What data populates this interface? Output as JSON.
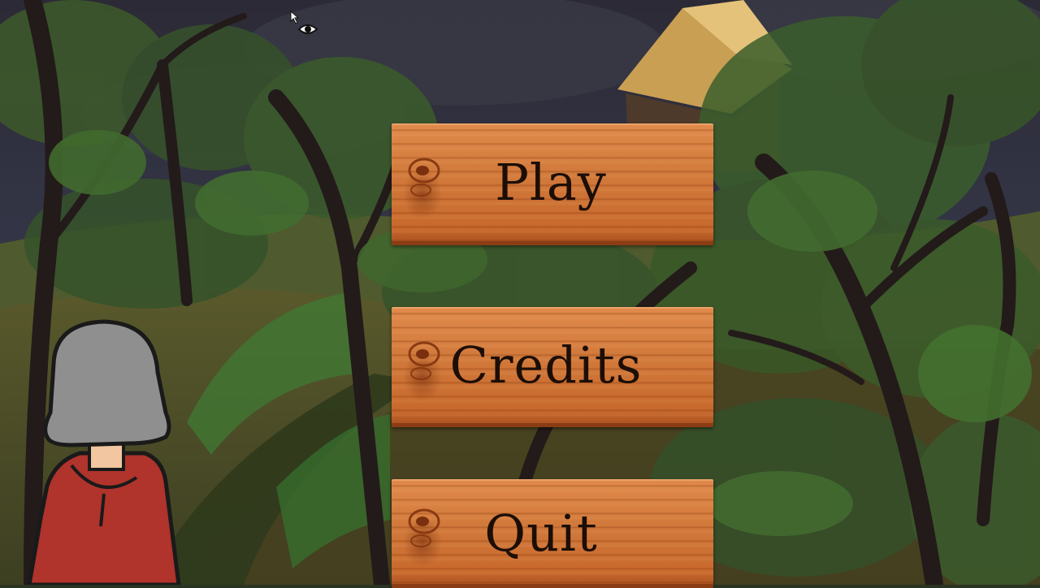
{
  "menu": {
    "play_label": "Play",
    "credits_label": "Credits",
    "quit_label": "Quit"
  },
  "icons": {
    "cursor": "arrow-with-eye-cursor-icon",
    "character": "grey-haired-red-hooded-character"
  },
  "colors": {
    "wood_light": "#e08a4c",
    "wood_dark": "#a84f1f",
    "label_text": "#1c0e06",
    "sky": "#2e2c38",
    "foliage": "#3b5a2a",
    "hood": "#b0332c",
    "hair": "#8c8c8c"
  }
}
